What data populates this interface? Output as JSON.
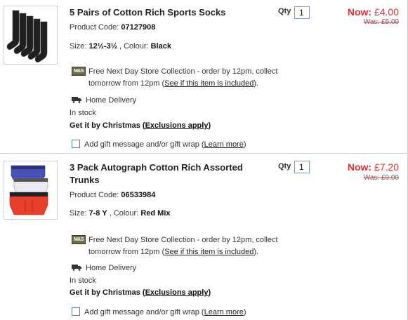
{
  "items": [
    {
      "title": "5 Pairs of Cotton Rich Sports Socks",
      "code_label": "Product Code:",
      "code": "07127908",
      "size_label": "Size:",
      "size": "12½-3½",
      "colour_label": ", Colour:",
      "colour": "Black",
      "qty_label": "Qty",
      "qty": "1",
      "now_label": "Now:",
      "now_price": "£4.00",
      "was_price": "Was: £5.00",
      "store_icon_text": "M&S",
      "store_text_1": "Free Next Day Store Collection - order by 12pm, collect tomorrow from 12pm (",
      "store_link": "See if this item is included",
      "store_text_2": ").",
      "delivery": "Home Delivery",
      "stock": "In stock",
      "xmas_text": "Get it by Christmas (",
      "xmas_link": "Exclusions apply",
      "xmas_end": ")",
      "gift_text": "Add gift message and/or gift wrap (",
      "gift_link": "Learn more",
      "gift_end": ")"
    },
    {
      "title": "3 Pack Autograph Cotton Rich Assorted Trunks",
      "code_label": "Product Code:",
      "code": "06533984",
      "size_label": "Size:",
      "size": "7-8 Y",
      "colour_label": ", Colour:",
      "colour": "Red Mix",
      "qty_label": "Qty",
      "qty": "1",
      "now_label": "Now:",
      "now_price": "£7.20",
      "was_price": "Was: £9.00",
      "store_icon_text": "M&S",
      "store_text_1": "Free Next Day Store Collection - order by 12pm, collect tomorrow from 12pm (",
      "store_link": "See if this item is included",
      "store_text_2": ").",
      "delivery": "Home Delivery",
      "stock": "In stock",
      "xmas_text": "Get it by Christmas (",
      "xmas_link": "Exclusions apply",
      "xmas_end": ")",
      "gift_text": "Add gift message and/or gift wrap (",
      "gift_link": "Learn more",
      "gift_end": ")"
    }
  ],
  "colors": {
    "price_red": "#e03030",
    "divider": "#cfcfcf",
    "input_border": "#7a99c6"
  }
}
